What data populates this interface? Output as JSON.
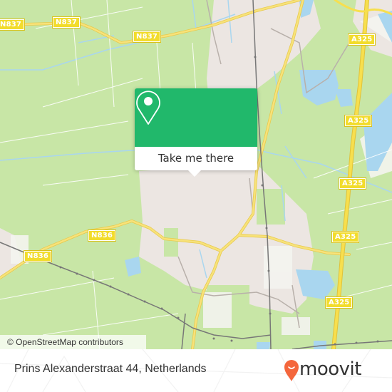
{
  "map": {
    "road_labels": [
      {
        "id": "n837-left",
        "text": "N837"
      },
      {
        "id": "n837-mid",
        "text": "N837"
      },
      {
        "id": "n836-left",
        "text": "N836"
      },
      {
        "id": "n836-mid",
        "text": "N836"
      },
      {
        "id": "a325-1",
        "text": "A325"
      },
      {
        "id": "a325-2",
        "text": "A325"
      },
      {
        "id": "a325-3",
        "text": "A325"
      },
      {
        "id": "a325-4",
        "text": "A325"
      },
      {
        "id": "a325-5",
        "text": "A325"
      }
    ],
    "attribution": "© OpenStreetMap contributors",
    "colors": {
      "land": "#c8e6a6",
      "urban": "#ece6e2",
      "water": "#a9d6ef",
      "road_major": "#f5dc5a",
      "rail": "#777777",
      "shield": "#f2dc2c"
    }
  },
  "popup": {
    "icon": "map-pin-icon",
    "action_label": "Take me there",
    "color": "#21b86b"
  },
  "footer": {
    "address": "Prins Alexanderstraat 44, Netherlands",
    "brand": "moovit",
    "brand_icon": "moovit-pin-logo-icon",
    "brand_color": "#f4663c"
  }
}
